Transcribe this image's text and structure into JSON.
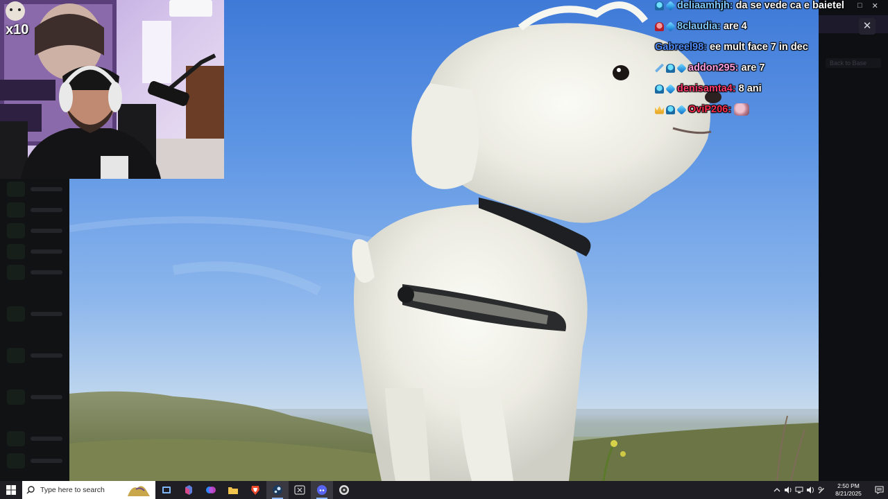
{
  "stream": {
    "multiplier": "x10"
  },
  "chat": [
    {
      "user": "deliaamhjh",
      "color": "#7ec8ff",
      "badges": [
        "ghost",
        "cube"
      ],
      "message": "da se vede ca e baietel"
    },
    {
      "user": "8claudia",
      "color": "#7ec8ff",
      "badges": [
        "red",
        "cube"
      ],
      "message": "are 4"
    },
    {
      "user": "Gabreel98",
      "color": "#4f8dff",
      "badges": [],
      "message": "ee mult face 7 in dec"
    },
    {
      "user": "addon295",
      "color": "#ff9ee0",
      "badges": [
        "tool",
        "ghost",
        "cube"
      ],
      "message": "are 7"
    },
    {
      "user": "denisamta4",
      "color": "#ff3b6b",
      "badges": [
        "ghost",
        "cube"
      ],
      "message": "8 ani"
    },
    {
      "user": "OviP206",
      "color": "#ff2d4f",
      "badges": [
        "crown",
        "ghost",
        "cube"
      ],
      "message": "",
      "emote": "emote-pig"
    }
  ],
  "overlay": {
    "close_symbol": "✕",
    "faint_text": "Back to Base"
  },
  "window": {
    "minimize": "□",
    "close": "✕"
  },
  "taskbar": {
    "search_placeholder": "Type here to search",
    "apps": [
      {
        "name": "file-explorer-window-icon",
        "active": false
      },
      {
        "name": "microsoft-365-icon",
        "active": false
      },
      {
        "name": "copilot-icon",
        "active": false
      },
      {
        "name": "file-explorer-icon",
        "active": false
      },
      {
        "name": "brave-browser-icon",
        "active": false
      },
      {
        "name": "steam-icon",
        "active": true
      },
      {
        "name": "xbox-icon",
        "active": false
      },
      {
        "name": "discord-icon",
        "active": true
      },
      {
        "name": "obs-icon",
        "active": false
      }
    ],
    "time": "2:50 PM",
    "date": "8/21/2025"
  },
  "colors": {
    "taskbar": "#1f1e24",
    "sky_top": "#3f7ad8",
    "accent": "#8fb7ff"
  }
}
